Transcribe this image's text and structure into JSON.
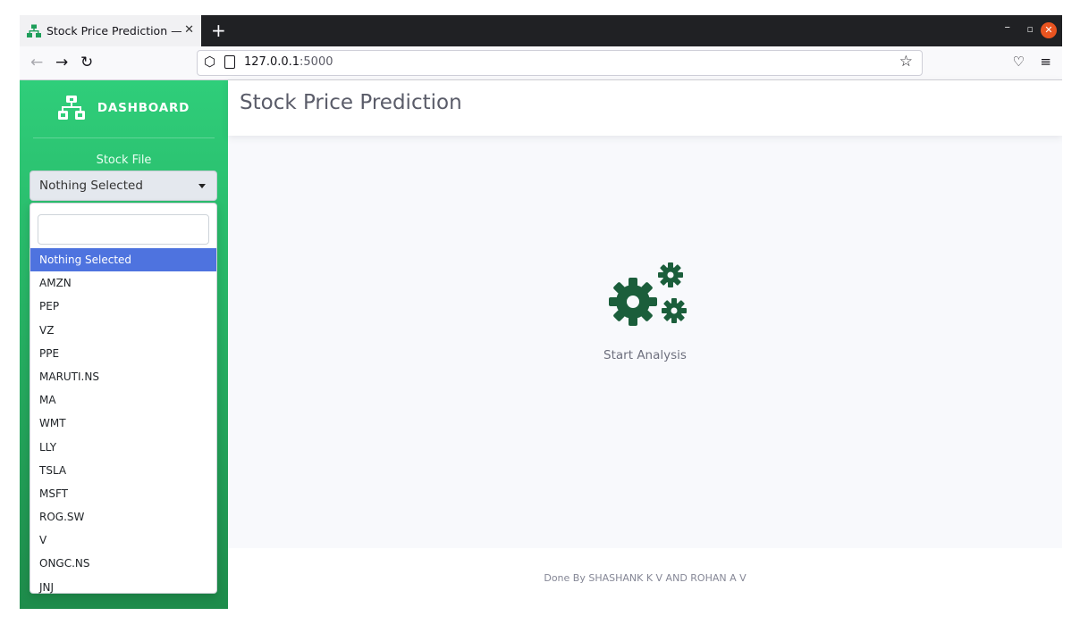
{
  "browser": {
    "tab_title": "Stock Price Prediction — [",
    "tab_close": "✕",
    "new_tab": "+",
    "url_host": "127.0.0.1",
    "url_port": ":5000"
  },
  "sidebar": {
    "brand": "DASHBOARD",
    "stock_label": "Stock File",
    "select_value": "Nothing Selected",
    "options": [
      "Nothing Selected",
      "AMZN",
      "PEP",
      "VZ",
      "PPE",
      "MARUTI.NS",
      "MA",
      "WMT",
      "LLY",
      "TSLA",
      "MSFT",
      "ROG.SW",
      "V",
      "ONGC.NS",
      "JNJ"
    ]
  },
  "header": {
    "title": "Stock Price Prediction"
  },
  "main": {
    "start_label": "Start Analysis"
  },
  "footer": {
    "text": "Done By SHASHANK K V AND ROHAN A V"
  },
  "colors": {
    "sidebar_top": "#2fce7a",
    "sidebar_bottom": "#1e8c4b",
    "selected_option": "#4e73df",
    "gear_icon": "#1b5e3b"
  },
  "icons": [
    "sitemap-icon",
    "gears-icon",
    "back-arrow-icon",
    "forward-arrow-icon",
    "reload-icon",
    "shield-icon",
    "page-icon",
    "bookmark-star-icon",
    "pocket-icon",
    "menu-icon"
  ]
}
